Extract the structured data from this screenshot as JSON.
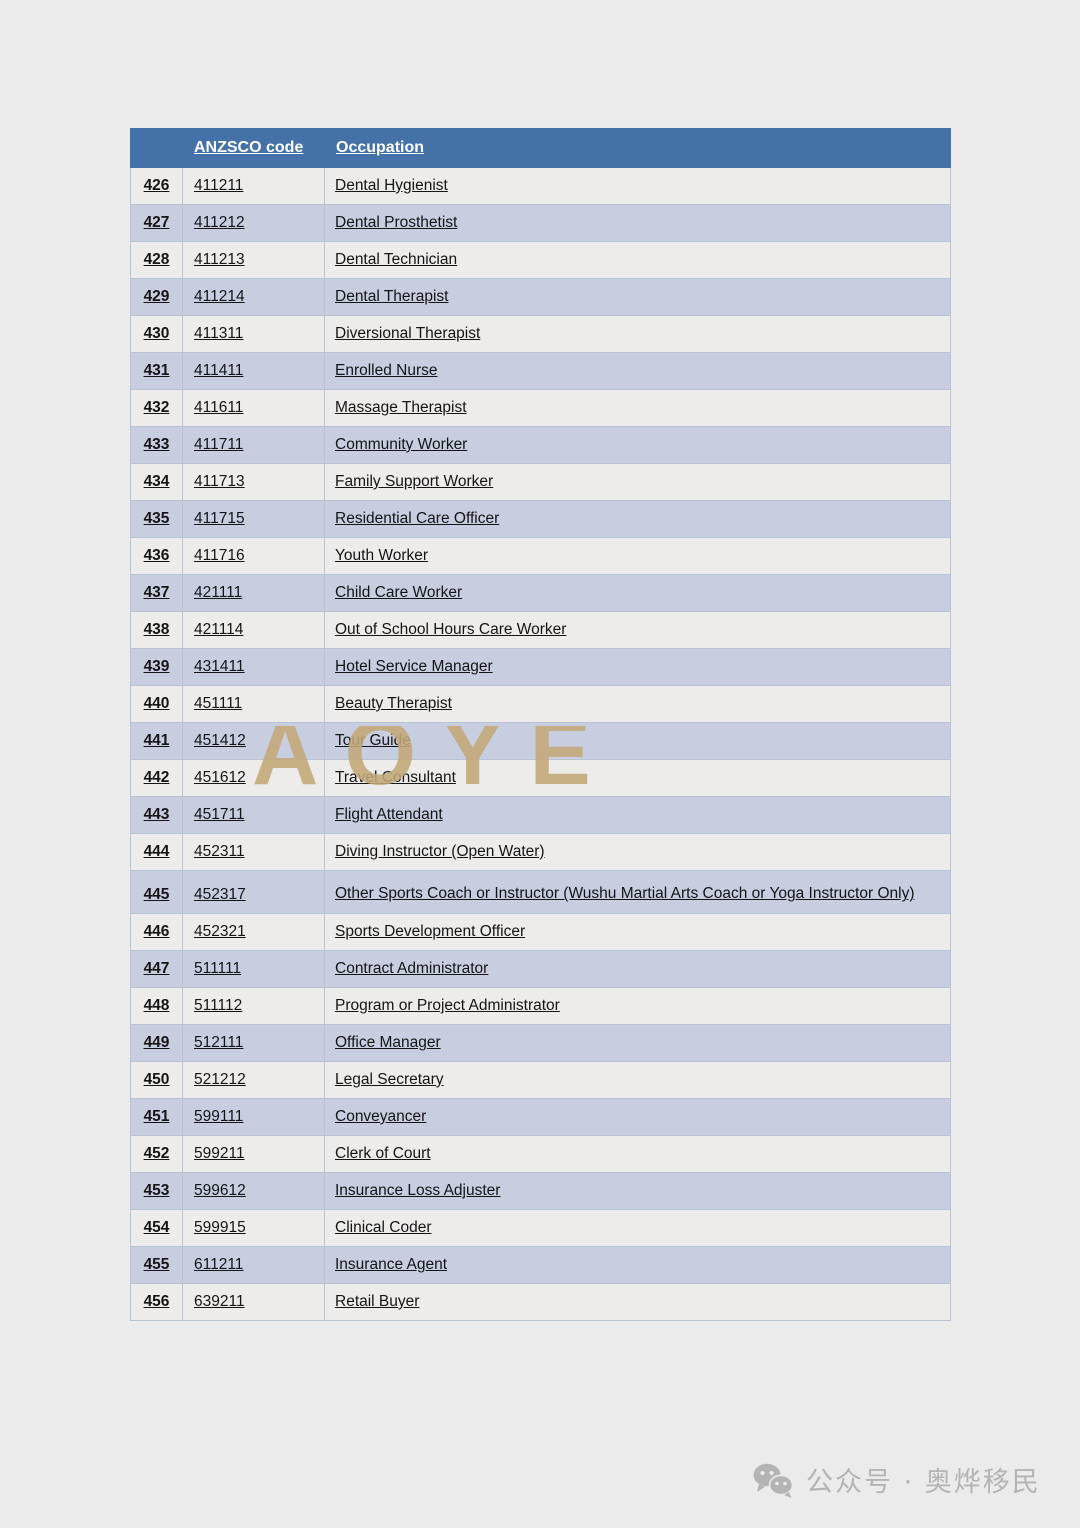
{
  "document": {
    "watermark": "AOYE",
    "background_color": "#ebebeb"
  },
  "table": {
    "header_color": "#4472a8",
    "row_color_light": "#edecea",
    "row_color_blue": "#c6cee0",
    "columns": [
      "",
      "ANZSCO code",
      "Occupation"
    ],
    "rows": [
      {
        "index": "426",
        "code": "411211",
        "occupation": "Dental Hygienist"
      },
      {
        "index": "427",
        "code": "411212",
        "occupation": "Dental Prosthetist"
      },
      {
        "index": "428",
        "code": "411213",
        "occupation": "Dental Technician"
      },
      {
        "index": "429",
        "code": "411214",
        "occupation": "Dental Therapist"
      },
      {
        "index": "430",
        "code": "411311",
        "occupation": "Diversional Therapist"
      },
      {
        "index": "431",
        "code": "411411",
        "occupation": "Enrolled Nurse"
      },
      {
        "index": "432",
        "code": "411611",
        "occupation": "Massage Therapist"
      },
      {
        "index": "433",
        "code": "411711",
        "occupation": "Community Worker"
      },
      {
        "index": "434",
        "code": "411713",
        "occupation": "Family Support Worker"
      },
      {
        "index": "435",
        "code": "411715",
        "occupation": "Residential Care Officer"
      },
      {
        "index": "436",
        "code": "411716",
        "occupation": "Youth Worker"
      },
      {
        "index": "437",
        "code": "421111",
        "occupation": "Child Care Worker"
      },
      {
        "index": "438",
        "code": "421114",
        "occupation": "Out of School Hours Care Worker"
      },
      {
        "index": "439",
        "code": "431411",
        "occupation": "Hotel Service Manager"
      },
      {
        "index": "440",
        "code": "451111",
        "occupation": "Beauty Therapist"
      },
      {
        "index": "441",
        "code": "451412",
        "occupation": "Tour Guide"
      },
      {
        "index": "442",
        "code": "451612",
        "occupation": "Travel Consultant"
      },
      {
        "index": "443",
        "code": "451711",
        "occupation": "Flight Attendant"
      },
      {
        "index": "444",
        "code": "452311",
        "occupation": "Diving Instructor (Open Water)"
      },
      {
        "index": "445",
        "code": "452317",
        "occupation": "Other Sports Coach or Instructor (Wushu Martial Arts Coach or Yoga Instructor Only)",
        "tall": true
      },
      {
        "index": "446",
        "code": "452321",
        "occupation": "Sports Development Officer"
      },
      {
        "index": "447",
        "code": "511111",
        "occupation": "Contract Administrator"
      },
      {
        "index": "448",
        "code": "511112",
        "occupation": "Program or Project Administrator"
      },
      {
        "index": "449",
        "code": "512111",
        "occupation": "Office Manager"
      },
      {
        "index": "450",
        "code": "521212",
        "occupation": "Legal Secretary"
      },
      {
        "index": "451",
        "code": "599111",
        "occupation": "Conveyancer"
      },
      {
        "index": "452",
        "code": "599211",
        "occupation": "Clerk of Court"
      },
      {
        "index": "453",
        "code": "599612",
        "occupation": "Insurance Loss Adjuster"
      },
      {
        "index": "454",
        "code": "599915",
        "occupation": "Clinical Coder"
      },
      {
        "index": "455",
        "code": "611211",
        "occupation": "Insurance Agent"
      },
      {
        "index": "456",
        "code": "639211",
        "occupation": "Retail Buyer"
      }
    ]
  },
  "footer": {
    "brand_text": "公众号 · 奥烨移民",
    "icon": "wechat-icon",
    "color": "#b4b4b4"
  }
}
